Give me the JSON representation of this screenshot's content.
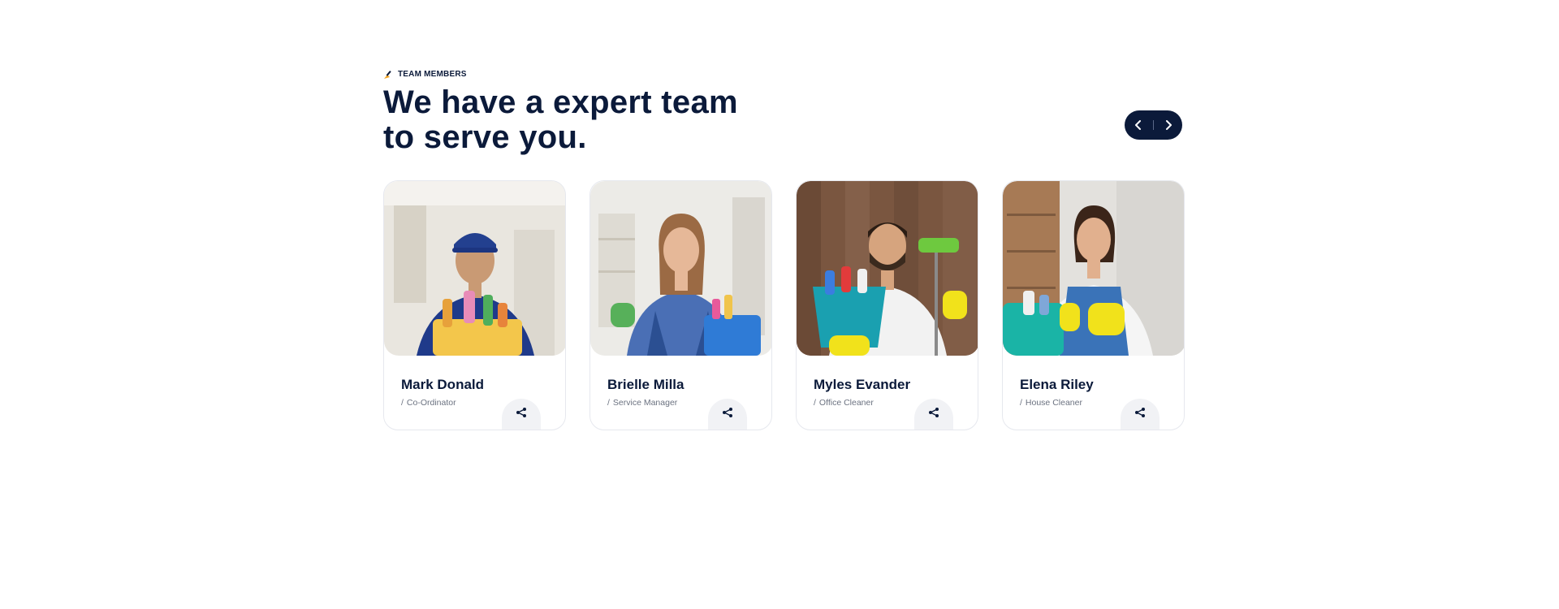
{
  "section": {
    "subtitle": "TEAM MEMBERS",
    "subtitle_icon": "broom-icon",
    "heading_line1": "We have a expert team",
    "heading_line2": "to serve you."
  },
  "navigation": {
    "prev_icon": "chevron-left-icon",
    "next_icon": "chevron-right-icon",
    "bg_color": "#0b1a3a"
  },
  "team": [
    {
      "name": "Mark Donald",
      "role": "Co-Ordinator",
      "share_icon": "share-icon"
    },
    {
      "name": "Brielle Milla",
      "role": "Service Manager",
      "share_icon": "share-icon"
    },
    {
      "name": "Myles Evander",
      "role": "Office Cleaner",
      "share_icon": "share-icon"
    },
    {
      "name": "Elena Riley",
      "role": "House Cleaner",
      "share_icon": "share-icon"
    }
  ],
  "colors": {
    "primary": "#0b1a3a",
    "accent": "#f5a623",
    "muted": "#6b7280"
  }
}
